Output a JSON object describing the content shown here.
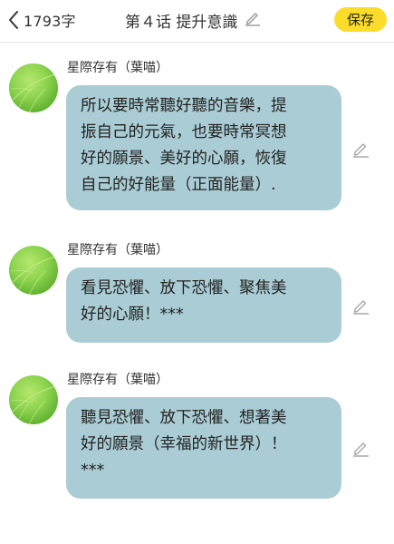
{
  "header": {
    "word_count": "1793字",
    "title": "第４话 提升意識",
    "save_label": "保存"
  },
  "messages": [
    {
      "sender": "星際存有（葉喵）",
      "text": "所以要時常聽好聽的音樂，提\n振自己的元氣，也要時常冥想\n好的願景、美好的心願，恢復\n自己的好能量（正面能量）."
    },
    {
      "sender": "星際存有（葉喵）",
      "text": "看見恐懼、放下恐懼、聚焦美\n好的心願！***"
    },
    {
      "sender": "星際存有（葉喵）",
      "text": "聽見恐懼、放下恐懼、想著美\n好的願景（幸福的新世界）！\n***"
    }
  ],
  "colors": {
    "save_button": "#fbdc2a",
    "bubble": "#aacdd5",
    "avatar": "#8ed450"
  },
  "icons": {
    "back": "chevron-left-icon",
    "edit": "pencil-icon"
  }
}
